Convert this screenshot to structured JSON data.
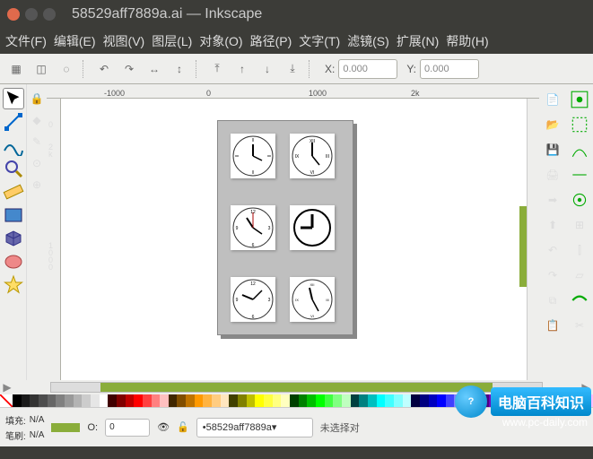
{
  "title": "58529aff7889a.ai — Inkscape",
  "menus": [
    "文件(F)",
    "编辑(E)",
    "视图(V)",
    "图层(L)",
    "对象(O)",
    "路径(P)",
    "文字(T)",
    "滤镜(S)",
    "扩展(N)",
    "帮助(H)"
  ],
  "toolbar": {
    "x_label": "X:",
    "y_label": "Y:",
    "x_value": "0.000",
    "y_value": "0.000"
  },
  "ruler_h": {
    "m1000": "-1000",
    "zero": "0",
    "p1000": "1000",
    "p2k": "2k"
  },
  "ruler_v": {
    "zero": "0",
    "p1000": "1\n0\n0\n0",
    "p2k": "2\nk"
  },
  "status": {
    "fill_label": "填充:",
    "stroke_label": "笔刷:",
    "na": "N/A",
    "opacity_label": "O:",
    "opacity_value": "0",
    "layer_value": "58529aff7889a",
    "selection_msg": "未选择对",
    "watermark": "www.pc-daily.com",
    "brand": "电脑百科知识"
  },
  "palette_colors": [
    "#000000",
    "#1a1a1a",
    "#333333",
    "#4d4d4d",
    "#666666",
    "#808080",
    "#999999",
    "#b3b3b3",
    "#cccccc",
    "#e6e6e6",
    "#ffffff",
    "#400000",
    "#800000",
    "#bf0000",
    "#ff0000",
    "#ff4040",
    "#ff8080",
    "#ffbfbf",
    "#402600",
    "#804d00",
    "#bf7300",
    "#ff9900",
    "#ffb340",
    "#ffcc80",
    "#ffe6bf",
    "#404000",
    "#808000",
    "#bfbf00",
    "#ffff00",
    "#ffff40",
    "#ffff80",
    "#ffffbf",
    "#004000",
    "#008000",
    "#00bf00",
    "#00ff00",
    "#40ff40",
    "#80ff80",
    "#bfffbf",
    "#004040",
    "#008080",
    "#00bfbf",
    "#00ffff",
    "#40ffff",
    "#80ffff",
    "#bfffff",
    "#000040",
    "#000080",
    "#0000bf",
    "#0000ff",
    "#4040ff",
    "#8080ff",
    "#bfbfff",
    "#260040",
    "#4d0080",
    "#7300bf",
    "#9900ff",
    "#b340ff",
    "#cc80ff",
    "#e6bfff",
    "#400040",
    "#800080",
    "#bf00bf",
    "#ff00ff",
    "#ff40ff",
    "#ff80ff",
    "#ffbfff"
  ]
}
